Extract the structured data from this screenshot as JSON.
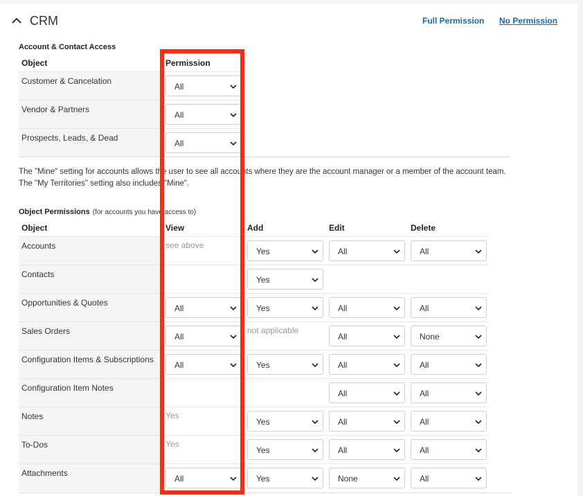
{
  "header": {
    "title": "CRM",
    "full_permission": "Full Permission",
    "no_permission": "No Permission"
  },
  "account_access": {
    "title": "Account & Contact Access",
    "col_object": "Object",
    "col_permission": "Permission",
    "rows": [
      {
        "label": "Customer & Cancelation",
        "permission": "All"
      },
      {
        "label": "Vendor & Partners",
        "permission": "All"
      },
      {
        "label": "Prospects, Leads, & Dead",
        "permission": "All"
      }
    ]
  },
  "explanation": {
    "line1": "The \"Mine\" setting for accounts allows the user to see all accounts where they are the account manager or a member of the account team.",
    "line2": "The \"My Territories\" setting also includes \"Mine\"."
  },
  "object_permissions": {
    "title": "Object Permissions",
    "note": "(for accounts you have access to)",
    "col_object": "Object",
    "col_view": "View",
    "col_add": "Add",
    "col_edit": "Edit",
    "col_delete": "Delete",
    "rows": [
      {
        "label": "Accounts",
        "view_text": "see above",
        "add": "Yes",
        "edit": "All",
        "delete": "All"
      },
      {
        "label": "Contacts",
        "add": "Yes"
      },
      {
        "label": "Opportunities & Quotes",
        "view": "All",
        "add": "Yes",
        "edit": "All",
        "delete": "All"
      },
      {
        "label": "Sales Orders",
        "view": "All",
        "add_text": "not applicable",
        "edit": "All",
        "delete": "None"
      },
      {
        "label": "Configuration Items & Subscriptions",
        "view": "All",
        "add": "Yes",
        "edit": "All",
        "delete": "All"
      },
      {
        "label": "Configuration Item Notes",
        "edit": "All",
        "delete": "All"
      },
      {
        "label": "Notes",
        "view_text": "Yes",
        "add": "Yes",
        "edit": "All",
        "delete": "All"
      },
      {
        "label": "To-Dos",
        "view_text": "Yes",
        "add": "Yes",
        "edit": "All",
        "delete": "All"
      },
      {
        "label": "Attachments",
        "view": "All",
        "add": "Yes",
        "edit": "None",
        "delete": "All"
      }
    ]
  },
  "colors": {
    "link": "#1a6aa6",
    "highlight_box": "#ff2a0f",
    "row_shade": "#f5f5f5"
  },
  "icons": {
    "collapse": "chevron-up-icon",
    "dropdown": "chevron-down-icon"
  }
}
